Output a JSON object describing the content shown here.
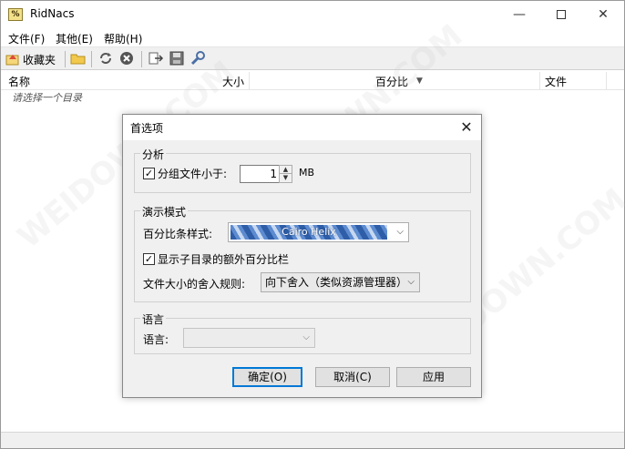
{
  "app": {
    "title": "RidNacs",
    "icon_text": "%"
  },
  "window_controls": {
    "minimize": "—",
    "maximize_icon": "maximize-icon",
    "close": "✕"
  },
  "menu": [
    "文件(F)",
    "其他(E)",
    "帮助(H)"
  ],
  "toolbar": {
    "favorites_label": "收藏夹",
    "icons": [
      "favorites-icon",
      "open-folder-icon",
      "refresh-icon",
      "stop-icon",
      "export-icon",
      "save-icon",
      "settings-wrench-icon"
    ]
  },
  "list": {
    "columns": [
      "名称",
      "大小",
      "百分比",
      "文件"
    ],
    "sort_indicator": "▼",
    "empty_hint": "请选择一个目录"
  },
  "dialog": {
    "title": "首选项",
    "close": "✕",
    "analysis": {
      "group_label": "分析",
      "group_files_label": "分组文件小于:",
      "group_files_checked": true,
      "group_files_value": "1",
      "unit": "MB"
    },
    "display": {
      "group_label": "演示模式",
      "bar_style_label": "百分比条样式:",
      "bar_style_value": "Cairo Helix",
      "extra_bar_label": "显示子目录的额外百分比栏",
      "extra_bar_checked": true,
      "rounding_label": "文件大小的舍入规则:",
      "rounding_value": "向下舍入（类似资源管理器）"
    },
    "language": {
      "group_label": "语言",
      "language_label": "语言:",
      "language_value": ""
    },
    "buttons": {
      "ok": "确定(O)",
      "cancel": "取消(C)",
      "apply": "应用"
    }
  },
  "watermark": "WEIDOWN.COM",
  "colors": {
    "accent": "#0078d7",
    "bar_dark": "#2f5ea8",
    "bar_light": "#c6d8f1"
  }
}
